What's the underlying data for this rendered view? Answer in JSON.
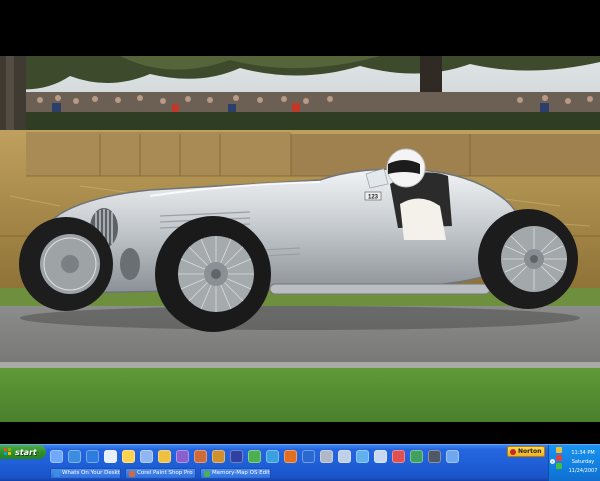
{
  "taskbar": {
    "start_label": "start",
    "quick_launch_icons": [
      {
        "name": "show-desktop-icon",
        "color": "#6fa8ff"
      },
      {
        "name": "internet-explorer-icon",
        "color": "#3b8de0"
      },
      {
        "name": "media-player-icon",
        "color": "#2e7be0"
      },
      {
        "name": "outlook-express-icon",
        "color": "#e8eef8"
      },
      {
        "name": "paint-icon",
        "color": "#ffd24d"
      },
      {
        "name": "folder-icon",
        "color": "#8fb6f0"
      },
      {
        "name": "windows-explorer-icon",
        "color": "#f0c040"
      },
      {
        "name": "picture-viewer-icon",
        "color": "#8a5fd0"
      },
      {
        "name": "photo-icon",
        "color": "#d06a3a"
      },
      {
        "name": "winamp-icon",
        "color": "#d09030"
      },
      {
        "name": "editor-icon",
        "color": "#3040a0"
      },
      {
        "name": "cut-tool-icon",
        "color": "#4caf50"
      },
      {
        "name": "globe-icon",
        "color": "#3aa0e0"
      },
      {
        "name": "firefox-icon",
        "color": "#e07020"
      },
      {
        "name": "shield-icon",
        "color": "#2a6ad0"
      },
      {
        "name": "player-icon",
        "color": "#b0b8c8"
      },
      {
        "name": "security-icon",
        "color": "#c0d0e8"
      },
      {
        "name": "messenger-icon",
        "color": "#60b0f0"
      },
      {
        "name": "disk-icon",
        "color": "#c8d8f0"
      },
      {
        "name": "color-wheel-icon",
        "color": "#e05050"
      },
      {
        "name": "network-icon",
        "color": "#40a060"
      },
      {
        "name": "battery-icon",
        "color": "#505868"
      },
      {
        "name": "window-icon",
        "color": "#70a8f0"
      }
    ],
    "tasks": [
      {
        "label": "Whats On Your Deskt...",
        "icon_color": "#3b8de0"
      },
      {
        "label": "Corel Paint Shop Pro X",
        "icon_color": "#d06a3a"
      },
      {
        "label": "Memory-Map OS Edit...",
        "icon_color": "#4caf50"
      }
    ],
    "norton_label": "Norton",
    "clock": {
      "time": "11:34 PM",
      "day": "Saturday",
      "date": "11/24/2007"
    },
    "tray_icons": [
      {
        "name": "tray-network-icon",
        "color": "#f0c030"
      },
      {
        "name": "tray-security-icon",
        "color": "#e04040"
      },
      {
        "name": "tray-volume-icon",
        "color": "#40c040"
      }
    ]
  },
  "wallpaper": {
    "car_number": "123"
  },
  "colors": {
    "taskbar": "#1f5fd8",
    "start_green": "#2f8f2a",
    "tray": "#127ee0"
  }
}
